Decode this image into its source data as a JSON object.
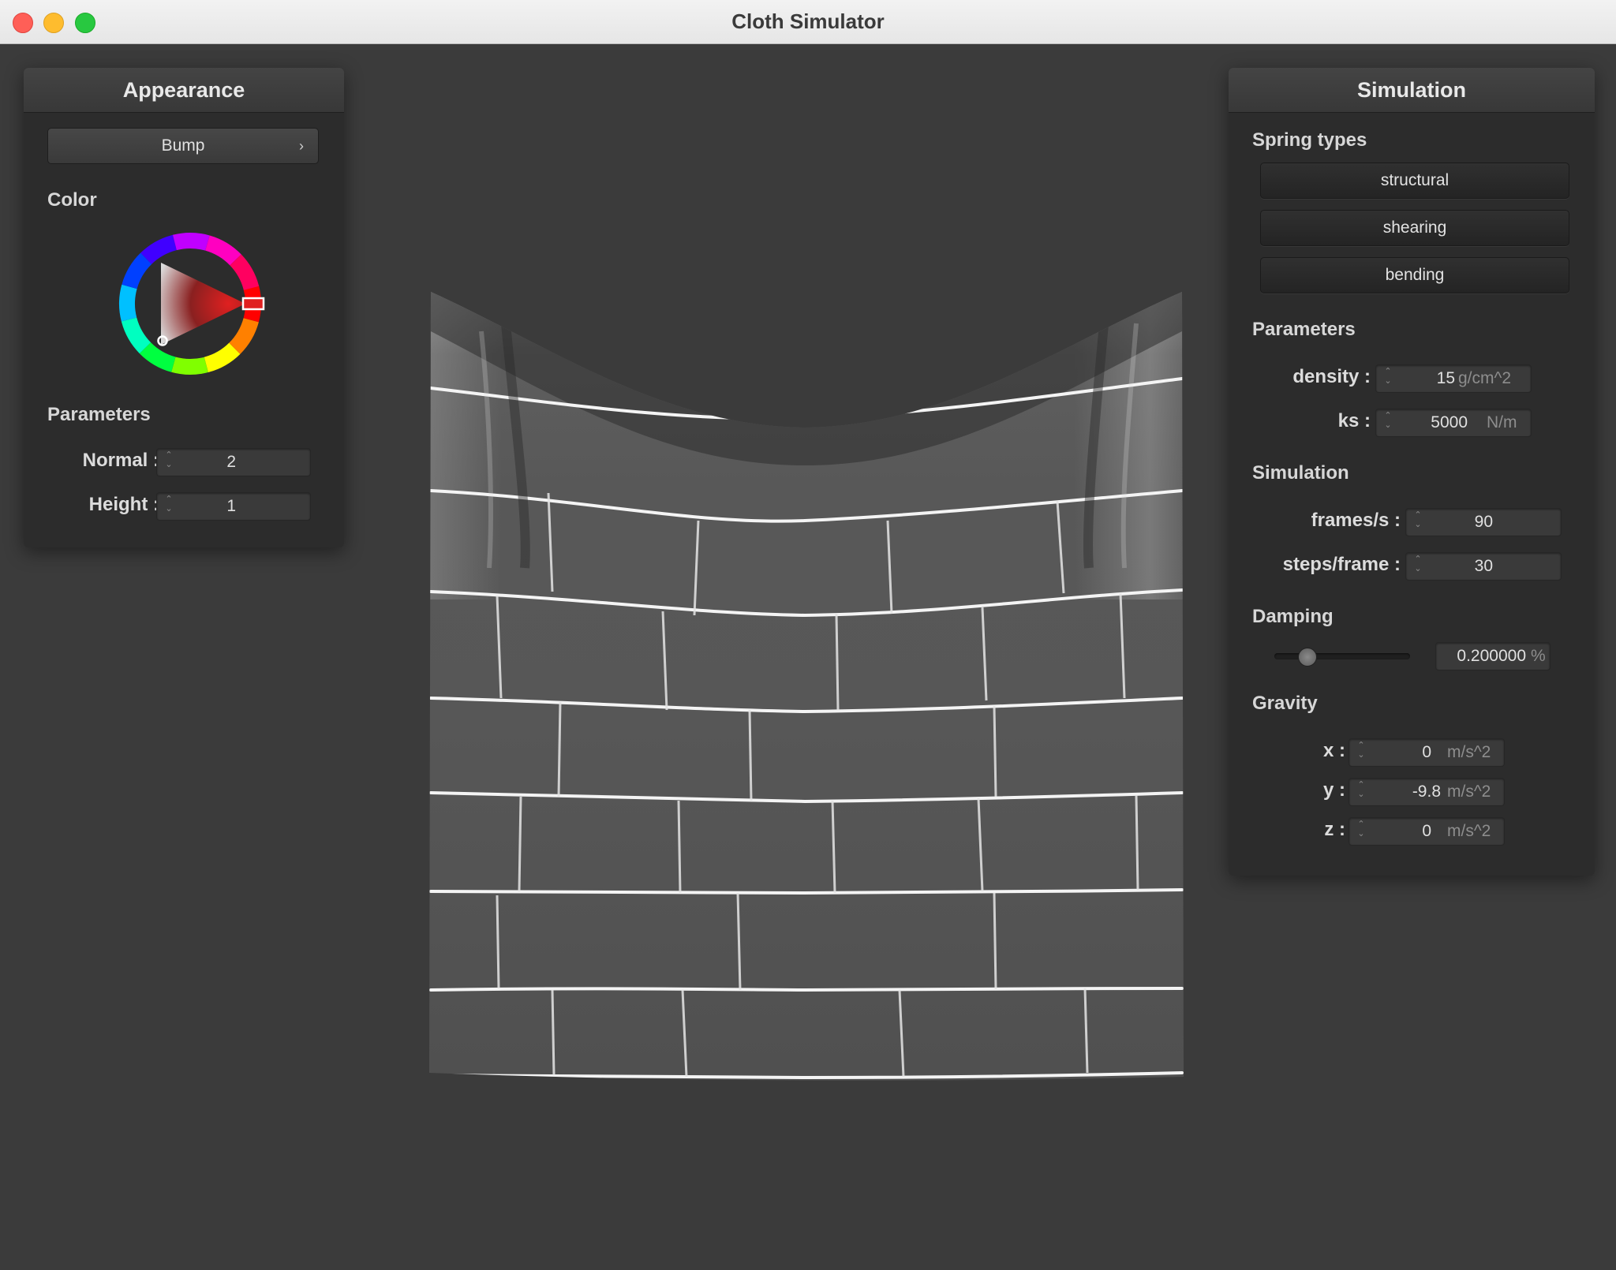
{
  "window": {
    "title": "Cloth Simulator"
  },
  "appearance": {
    "header": "Appearance",
    "shader_selected": "Bump",
    "color_label": "Color",
    "color_value": "#e02020",
    "parameters_label": "Parameters",
    "normal": {
      "label": "Normal :",
      "value": "2"
    },
    "height": {
      "label": "Height :",
      "value": "1"
    }
  },
  "simulation_panel": {
    "header": "Simulation",
    "spring_types_label": "Spring types",
    "spring_buttons": [
      "structural",
      "shearing",
      "bending"
    ],
    "parameters_label": "Parameters",
    "density": {
      "label": "density :",
      "value": "15",
      "unit": "g/cm^2"
    },
    "ks": {
      "label": "ks :",
      "value": "5000",
      "unit": "N/m"
    },
    "simulation_label": "Simulation",
    "frames_per_s": {
      "label": "frames/s :",
      "value": "90"
    },
    "steps_per_frame": {
      "label": "steps/frame :",
      "value": "30"
    },
    "damping_label": "Damping",
    "damping": {
      "value": "0.200000",
      "unit": "%",
      "slider_fraction": 0.2
    },
    "gravity_label": "Gravity",
    "gravity": [
      {
        "label": "x :",
        "value": "0",
        "unit": "m/s^2"
      },
      {
        "label": "y :",
        "value": "-9.8",
        "unit": "m/s^2"
      },
      {
        "label": "z :",
        "value": "0",
        "unit": "m/s^2"
      }
    ]
  }
}
